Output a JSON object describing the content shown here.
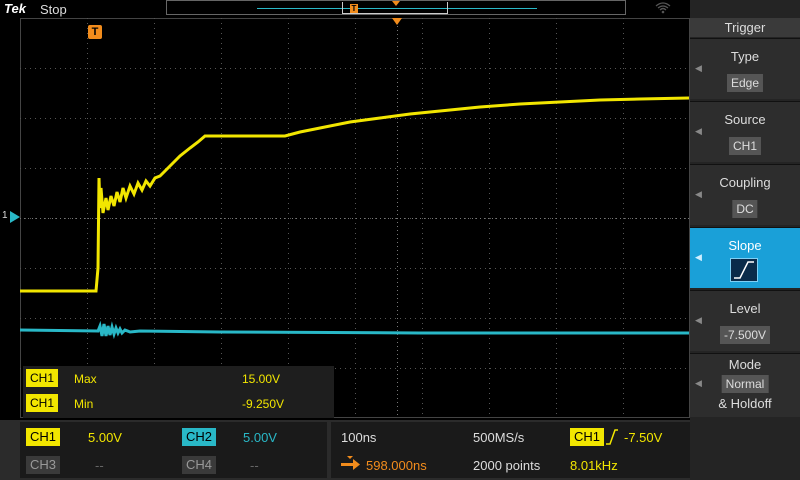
{
  "app": {
    "brand": "Tek",
    "run_state": "Stop"
  },
  "record_view": {
    "trigger_marker": "T"
  },
  "graticule": {
    "trigger_marker": "T",
    "ch1_marker": "1",
    "colors": {
      "ch1": "#f2e600",
      "ch2": "#29b8c7",
      "grid": "#555555",
      "trigger": "#f28c1c"
    }
  },
  "measurements": [
    {
      "channel": "CH1",
      "name": "Max",
      "value": "15.00V"
    },
    {
      "channel": "CH1",
      "name": "Min",
      "value": "-9.250V"
    }
  ],
  "channels": [
    {
      "label": "CH1",
      "scale": "5.00V",
      "color": "#f2e600"
    },
    {
      "label": "CH2",
      "scale": "5.00V",
      "color": "#29b8c7"
    },
    {
      "label": "CH3",
      "scale": "--",
      "color": "#555555"
    },
    {
      "label": "CH4",
      "scale": "--",
      "color": "#555555"
    }
  ],
  "horizontal": {
    "time_per_div": "100ns",
    "sample_rate": "500MS/s",
    "position": "598.000ns",
    "record_length": "2000 points"
  },
  "trigger_status": {
    "source": "CH1",
    "level": "-7.50V",
    "frequency": "8.01kHz"
  },
  "trigger_menu": {
    "title": "Trigger",
    "items": [
      {
        "label": "Type",
        "value": "Edge"
      },
      {
        "label": "Source",
        "value": "CH1"
      },
      {
        "label": "Coupling",
        "value": "DC"
      },
      {
        "label": "Slope",
        "value": "rising-edge-icon"
      },
      {
        "label": "Level",
        "value": "-7.500V"
      },
      {
        "label": "Mode",
        "value": "Normal",
        "extra": "& Holdoff"
      }
    ]
  }
}
